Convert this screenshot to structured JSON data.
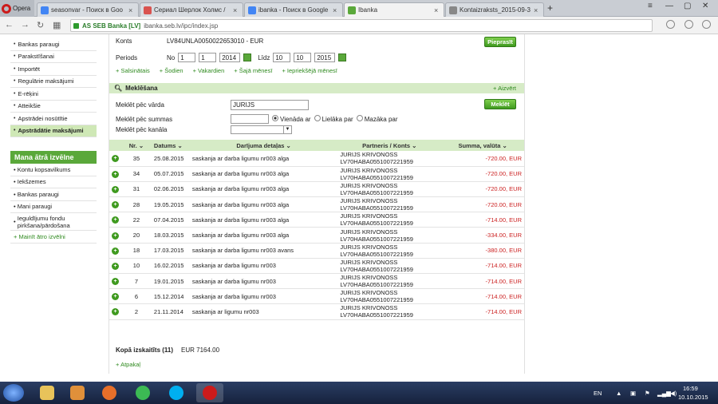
{
  "browser": {
    "menu_label": "Opera",
    "tabs": [
      {
        "label": "seasonvar - Поиск в Goo",
        "active": false
      },
      {
        "label": "Сериал Шерлок Холмс /",
        "active": false
      },
      {
        "label": "ibanka - Поиск в Google",
        "active": false
      },
      {
        "label": "Ibanka",
        "active": true
      },
      {
        "label": "Kontaizraksts_2015-09-3",
        "active": false
      }
    ],
    "ev_label": "AS SEB Banka [LV]",
    "url": "ibanka.seb.lv/ipc/index.jsp"
  },
  "sidebar": {
    "items": [
      {
        "label": "Bankas paraugi",
        "selected": false
      },
      {
        "label": "Parakstīšanai",
        "selected": false
      },
      {
        "label": "Importēt",
        "selected": false
      },
      {
        "label": "Regulārie maksājumi",
        "selected": false
      },
      {
        "label": "E-rēķini",
        "selected": false
      },
      {
        "label": "Atteikšie",
        "selected": false
      },
      {
        "label": "Apstrādei nosūtītie",
        "selected": false
      },
      {
        "label": "Apstrādātie maksājumi",
        "selected": true
      }
    ],
    "fast_title": "Mana ātrā izvēlne",
    "fast_items": [
      {
        "label": "Kontu kopsavilkums"
      },
      {
        "label": "Iekšzemes"
      },
      {
        "label": "Bankas paraugi"
      },
      {
        "label": "Mani paraugi"
      },
      {
        "label": "Ieguldījumu fondu pirkšana/pārdošana"
      },
      {
        "label": "Mainīt ātro izvēlni"
      }
    ]
  },
  "filter": {
    "account_label": "Konts",
    "account_value": "LV84UNLA0050022653010 - EUR",
    "select_button": "Pieprasīt",
    "period_label": "Periods",
    "from_label": "No",
    "from_day": "1",
    "from_month": "1",
    "from_year": "2014",
    "to_label": "Līdz",
    "to_day": "10",
    "to_month": "10",
    "to_year": "2015",
    "quick_ranges": [
      "Salsinātais",
      "Šodien",
      "Vakardien",
      "Šajā mēnesī",
      "Iepriekšējā mēnesī"
    ]
  },
  "search": {
    "title": "Meklēšana",
    "close_label": "Aizvērt",
    "by_name_label": "Meklēt pēc vārda",
    "name_value": "JURIJS",
    "search_button": "Meklēt",
    "by_amount_label": "Meklēt pēc summas",
    "amount_value": "",
    "radio_equal": "Vienāda ar",
    "radio_greater": "Lielāka par",
    "radio_less": "Mazāka par",
    "by_channel_label": "Meklēt pēc kanāla",
    "channel_value": ""
  },
  "table": {
    "headers": [
      "Nr.",
      "Datums",
      "Darījuma detaļas",
      "Partneris / Konts",
      "Summa, valūta"
    ],
    "rows": [
      {
        "nr": "35",
        "date": "25.08.2015",
        "details": "saskanja ar darba ligumu nr003 alga",
        "partner": "JURIJS KRIVONOSS",
        "account": "LV70HABA0551007221959",
        "amount": "-720.00, EUR"
      },
      {
        "nr": "34",
        "date": "05.07.2015",
        "details": "saskanja ar darba ligumu nr003 alga",
        "partner": "JURIJS KRIVONOSS",
        "account": "LV70HABA0551007221959",
        "amount": "-720.00, EUR"
      },
      {
        "nr": "31",
        "date": "02.06.2015",
        "details": "saskanja ar darba ligumu nr003 alga",
        "partner": "JURIJS KRIVONOSS",
        "account": "LV70HABA0551007221959",
        "amount": "-720.00, EUR"
      },
      {
        "nr": "28",
        "date": "19.05.2015",
        "details": "saskanja ar darba ligumu nr003 alga",
        "partner": "JURIJS KRIVONOSS",
        "account": "LV70HABA0551007221959",
        "amount": "-720.00, EUR"
      },
      {
        "nr": "22",
        "date": "07.04.2015",
        "details": "saskanja ar darba ligumu nr003 alga",
        "partner": "JURIJS KRIVONOSS",
        "account": "LV70HABA0551007221959",
        "amount": "-714.00, EUR"
      },
      {
        "nr": "20",
        "date": "18.03.2015",
        "details": "saskanja ar darba ligumu nr003 alga",
        "partner": "JURIJS KRIVONOSS",
        "account": "LV70HABA0551007221959",
        "amount": "-334.00, EUR"
      },
      {
        "nr": "18",
        "date": "17.03.2015",
        "details": "saskanja ar darba ligumu nr003 avans",
        "partner": "JURIJS KRIVONOSS",
        "account": "LV70HABA0551007221959",
        "amount": "-380.00, EUR"
      },
      {
        "nr": "10",
        "date": "16.02.2015",
        "details": "saskanja ar darba ligumu nr003",
        "partner": "JURIJS KRIVONOSS",
        "account": "LV70HABA0551007221959",
        "amount": "-714.00, EUR"
      },
      {
        "nr": "7",
        "date": "19.01.2015",
        "details": "saskanja ar darba ligumu nr003",
        "partner": "JURIJS KRIVONOSS",
        "account": "LV70HABA0551007221959",
        "amount": "-714.00, EUR"
      },
      {
        "nr": "6",
        "date": "15.12.2014",
        "details": "saskanja ar darba ligumu nr003",
        "partner": "JURIJS KRIVONOSS",
        "account": "LV70HABA0551007221959",
        "amount": "-714.00, EUR"
      },
      {
        "nr": "2",
        "date": "21.11.2014",
        "details": "saskanja ar ligumu nr003",
        "partner": "JURIJS KRIVONOSS",
        "account": "LV70HABA0551007221959",
        "amount": "-714.00, EUR"
      }
    ],
    "total_label": "Kopā izskaitīts (11)",
    "total_value": "EUR 7164.00",
    "back_label": "Atpakaļ"
  },
  "taskbar": {
    "lang": "EN",
    "time": "16:59",
    "date": "10.10.2015"
  },
  "colors": {
    "accent_green": "#5aa83a",
    "section_green": "#d6ebc6",
    "amount_red": "#cc2222"
  }
}
